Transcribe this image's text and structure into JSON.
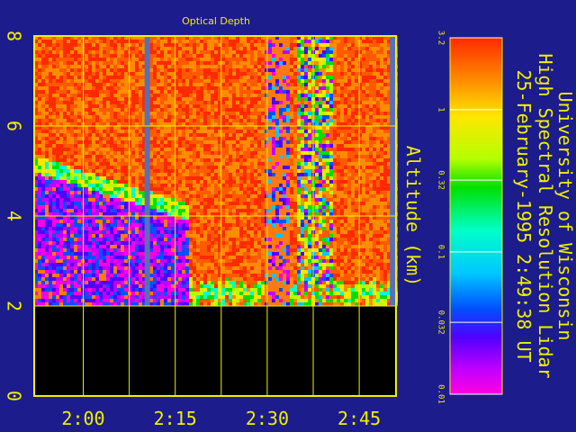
{
  "chart_data": {
    "type": "heatmap",
    "title": "Optical Depth",
    "ylabel": "Altitude (km)",
    "ylim": [
      0,
      8
    ],
    "yticks": [
      "0",
      "2",
      "4",
      "6",
      "8"
    ],
    "xlim": [
      "1:52",
      "2:51"
    ],
    "xticks": [
      "2:00",
      "2:15",
      "2:30",
      "2:45"
    ],
    "colorbar": {
      "scale": "log",
      "range": [
        0.01,
        3.2
      ],
      "ticks": [
        "3.2",
        "1",
        "0.32",
        "0.1",
        "0.032",
        "0.01"
      ]
    },
    "colors": {
      "background": "#1c1c8c",
      "axes": "#f0f000",
      "data_gap": "#5a6fb4",
      "ground": "#000000"
    },
    "side_text": [
      "University of Wisconsin",
      "High Spectral Resolution Lidar",
      "25-February-1995   2:49:38 UT"
    ]
  }
}
